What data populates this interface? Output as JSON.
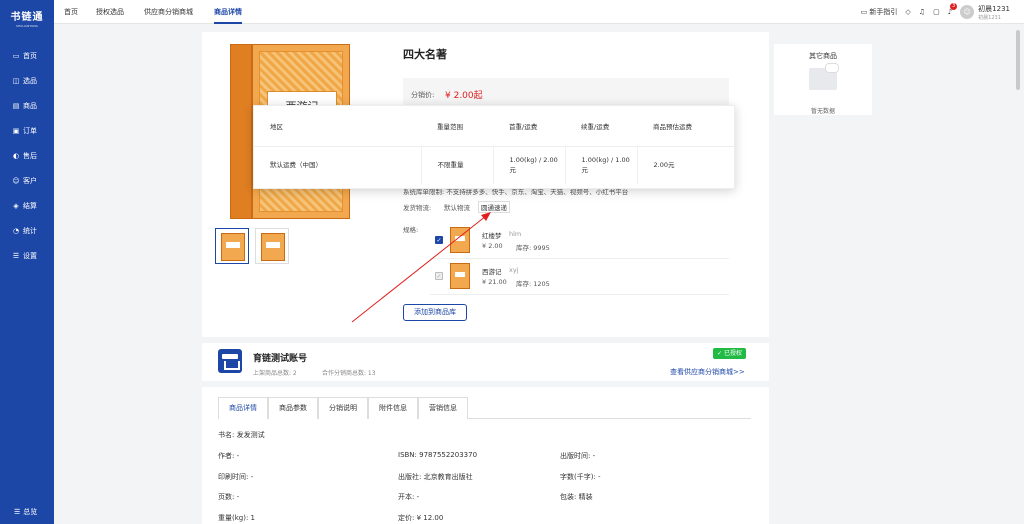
{
  "app": {
    "logo_main": "书链通",
    "logo_sub": "SHULIANTONG"
  },
  "sidebar": {
    "items": [
      {
        "label": "首页",
        "icon": "monitor-icon"
      },
      {
        "label": "选品",
        "icon": "pick-icon"
      },
      {
        "label": "商品",
        "icon": "goods-icon"
      },
      {
        "label": "订单",
        "icon": "order-icon"
      },
      {
        "label": "售后",
        "icon": "aftersale-icon"
      },
      {
        "label": "客户",
        "icon": "customer-icon"
      },
      {
        "label": "结算",
        "icon": "settle-icon"
      },
      {
        "label": "统计",
        "icon": "stats-icon"
      },
      {
        "label": "设置",
        "icon": "settings-icon"
      }
    ],
    "collapse_label": "总览"
  },
  "topnav": {
    "items": [
      "首页",
      "授权选品",
      "供应商分销商城",
      "商品详情"
    ],
    "active_index": 3
  },
  "toolbar": {
    "guide": "新手指引",
    "notification_count": "3",
    "user_name": "初晨1231",
    "user_sub": "初晨1231"
  },
  "product": {
    "title": "四大名著",
    "price_label": "分销价:",
    "price": "¥ 2.00起",
    "partial_row": "系统库单限制: 不支持拼多多、快手、京东、淘宝、天猫、视频号、小红书平台",
    "logistics_label": "发货物流:",
    "logistics_default": "默认物流",
    "logistics_option": "圆通速递",
    "spec_label": "规格:",
    "skus": [
      {
        "name": "红楼梦",
        "code": "hlm",
        "price": "¥ 2.00",
        "stock": "库存: 9995",
        "checked": true
      },
      {
        "name": "西游记",
        "code": "xyj",
        "price": "¥ 21.00",
        "stock": "库存: 1205",
        "checked": false
      }
    ],
    "add_button": "添加到商品库",
    "cover_title": "西游记"
  },
  "freight_popup": {
    "headers": [
      "地区",
      "重量范围",
      "首重/运费",
      "续重/运费",
      "商品预估运费"
    ],
    "row": [
      "默认运费（中国）",
      "不限重量",
      "1.00(kg) / 2.00 元",
      "1.00(kg) / 1.00 元",
      "2.00元"
    ]
  },
  "other_goods": {
    "title": "其它商品",
    "empty": "暂无数据"
  },
  "shop": {
    "name": "育链测试账号",
    "goods_count": "上架商品总数: 2",
    "partner_count": "合作分销商总数: 13",
    "auth_badge": "已授权",
    "mall_link": "查看供应商分销商城>>"
  },
  "tabs": [
    "商品详情",
    "商品参数",
    "分销说明",
    "附件信息",
    "营销信息"
  ],
  "attrs": {
    "book_name": "书名: 发发测试",
    "author": "作者: -",
    "isbn": "ISBN: 9787552203370",
    "pub_time": "出版时间: -",
    "print_time": "印刷时间: -",
    "publisher": "出版社: 北京教育出版社",
    "words": "字数(千字): -",
    "pages": "页数: -",
    "format": "开本: -",
    "binding": "包装: 精装",
    "weight": "重量(kg): 1",
    "list_price": "定价: ¥ 12.00"
  },
  "colors": {
    "brand": "#1d47a7",
    "price": "#e02020",
    "authorized": "#21ba45",
    "annotation": "#e02020"
  }
}
